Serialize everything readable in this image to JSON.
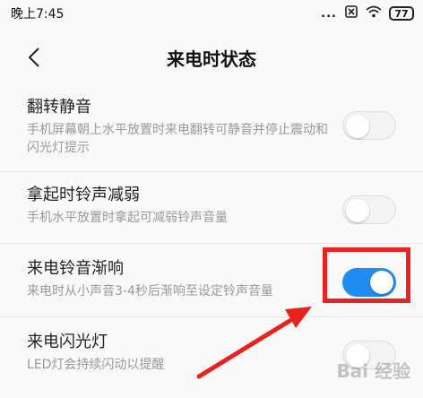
{
  "status_bar": {
    "time": "晚上7:45",
    "signal_dots": "...",
    "battery": "77"
  },
  "header": {
    "title": "来电时状态"
  },
  "settings": [
    {
      "title": "翻转静音",
      "description": "手机屏幕朝上水平放置时来电翻转可静音并停止震动和闪光灯提示",
      "enabled": false
    },
    {
      "title": "拿起时铃声减弱",
      "description": "手机水平放置时拿起可减弱铃声音量",
      "enabled": false
    },
    {
      "title": "来电铃音渐响",
      "description": "来电时从小声音3-4秒后渐响至设定铃声音量",
      "enabled": true
    },
    {
      "title": "来电闪光灯",
      "description": "LED灯会持续闪动以提醒",
      "enabled": false
    }
  ],
  "watermark": "Bai 经验",
  "colors": {
    "accent": "#1e8cf0",
    "highlight": "#e8231f"
  }
}
